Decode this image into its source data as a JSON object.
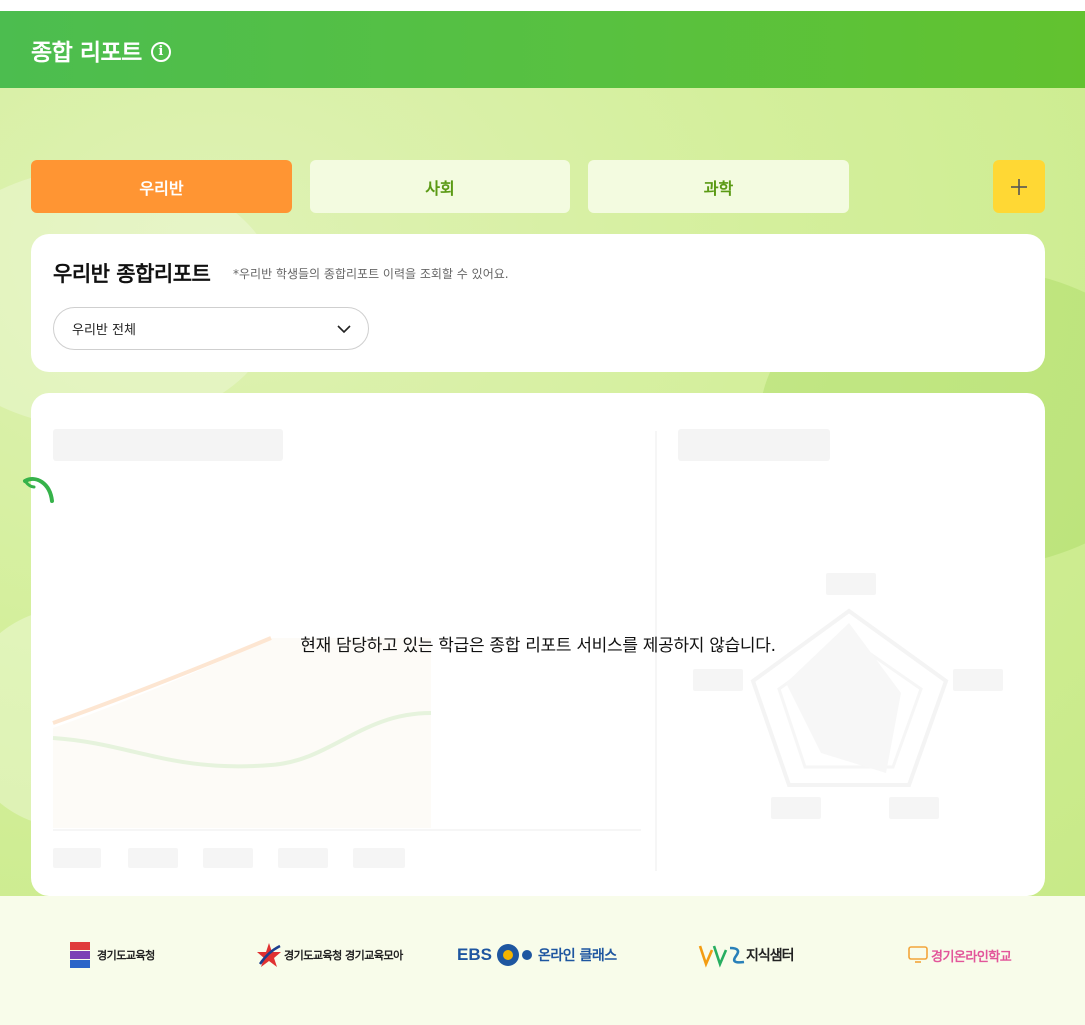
{
  "header": {
    "title": "종합 리포트",
    "info_icon": "info-icon"
  },
  "tabs": [
    {
      "label": "우리반",
      "active": true
    },
    {
      "label": "사회",
      "active": false
    },
    {
      "label": "과학",
      "active": false
    }
  ],
  "add_button": {
    "icon": "plus-icon"
  },
  "filter": {
    "title": "우리반 종합리포트",
    "note": "*우리반 학생들의 종합리포트 이력을 조회할 수 있어요.",
    "select_value": "우리반 전체"
  },
  "report": {
    "empty_message": "현재 담당하고 있는 학급은 종합 리포트 서비스를 제공하지 않습니다."
  },
  "footer": {
    "logos": [
      {
        "label": "경기도교육청"
      },
      {
        "label": "경기도교육청 경기교육모아"
      },
      {
        "label_a": "EBS",
        "label_b": "온라인 클래스"
      },
      {
        "label": "지식샘터"
      },
      {
        "label": "경기온라인학교"
      }
    ]
  },
  "colors": {
    "header_green": "#58c140",
    "tab_active": "#ff9533",
    "tab_inactive_bg": "#f3fbe0",
    "tab_inactive_text": "#5a9a14",
    "add_button": "#ffd834",
    "background": "#d4ef9c",
    "footer_bg": "#f8fcea"
  }
}
